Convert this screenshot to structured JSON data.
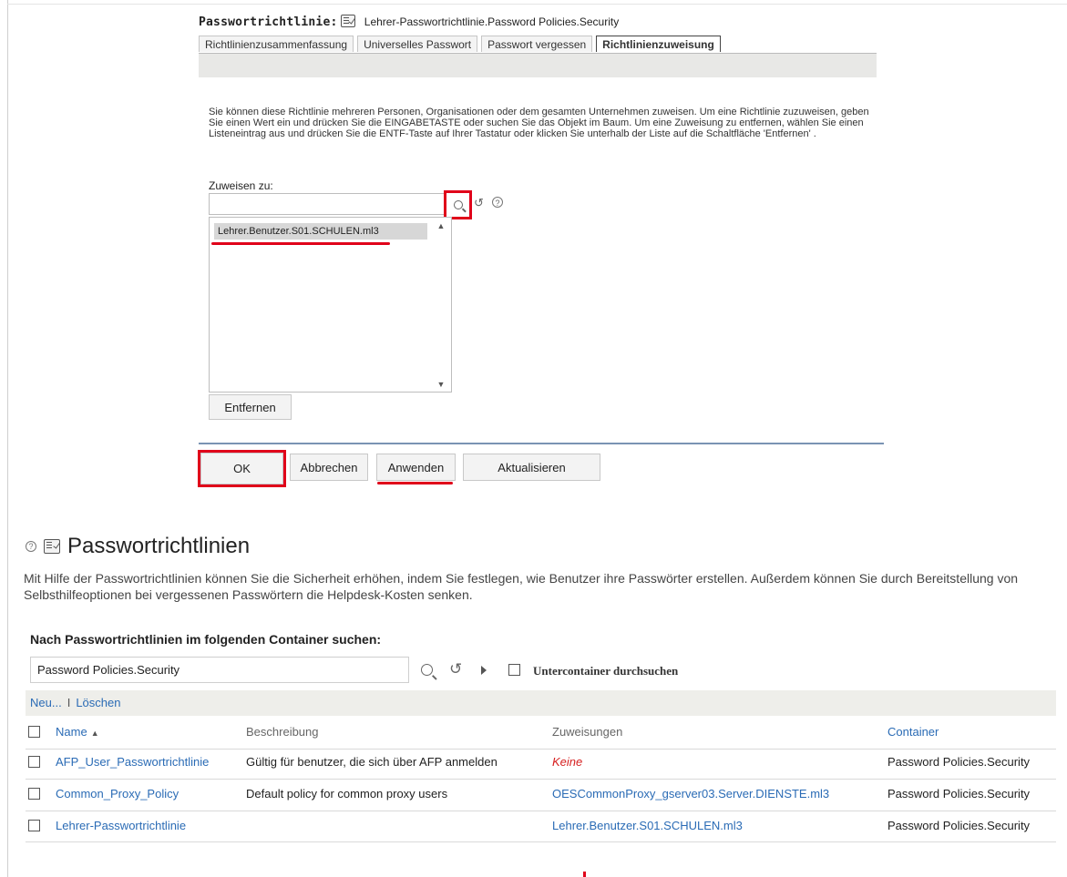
{
  "dialog": {
    "title_label": "Passwortrichtlinie:",
    "object_name": "Lehrer-Passwortrichtlinie.Password Policies.Security",
    "tabs": [
      {
        "label": "Richtlinienzusammenfassung",
        "active": false
      },
      {
        "label": "Universelles Passwort",
        "active": false
      },
      {
        "label": "Passwort vergessen",
        "active": false
      },
      {
        "label": "Richtlinienzuweisung",
        "active": true
      }
    ],
    "description": "Sie können diese Richtlinie mehreren Personen, Organisationen oder dem gesamten Unternehmen zuweisen. Um eine Richtlinie zuzuweisen, geben Sie einen Wert ein und drücken Sie die EINGABETASTE oder suchen Sie das Objekt im Baum. Um eine Zuweisung zu entfernen, wählen Sie einen Listeneintrag aus und drücken Sie die ENTF-Taste auf Ihrer Tastatur oder klicken Sie unterhalb der Liste auf die Schaltfläche 'Entfernen' .",
    "assign_label": "Zuweisen zu:",
    "assign_value": "",
    "assigned_items": [
      "Lehrer.Benutzer.S01.SCHULEN.ml3"
    ],
    "remove_button": "Entfernen",
    "buttons": {
      "ok": "OK",
      "cancel": "Abbrechen",
      "apply": "Anwenden",
      "refresh": "Aktualisieren"
    }
  },
  "page": {
    "title": "Passwortrichtlinien",
    "intro": "Mit Hilfe der Passwortrichtlinien können Sie die Sicherheit erhöhen, indem Sie festlegen, wie Benutzer ihre Passwörter erstellen. Außerdem können Sie durch Bereitstellung von Selbsthilfeoptionen bei vergessenen Passwörtern die Helpdesk-Kosten senken.",
    "search_label": "Nach Passwortrichtlinien im folgenden Container suchen:",
    "container_value": "Password Policies.Security",
    "subcontainer_label": "Untercontainer durchsuchen",
    "actions": {
      "new": "Neu...",
      "separator": "I",
      "delete": "Löschen"
    },
    "columns": {
      "name": "Name",
      "description": "Beschreibung",
      "assignments": "Zuweisungen",
      "container": "Container"
    },
    "rows": [
      {
        "name": "AFP_User_Passwortrichtlinie",
        "description": "Gültig für benutzer, die sich über AFP anmelden",
        "assignments": "Keine",
        "container": "Password Policies.Security"
      },
      {
        "name": "Common_Proxy_Policy",
        "description": "Default policy for common proxy users",
        "assignments": "OESCommonProxy_gserver03.Server.DIENSTE.ml3",
        "container": "Password Policies.Security"
      },
      {
        "name": "Lehrer-Passwortrichtlinie",
        "description": "",
        "assignments": "Lehrer.Benutzer.S01.SCHULEN.ml3",
        "container": "Password Policies.Security"
      }
    ]
  },
  "colors": {
    "highlight": "#e0001a",
    "link": "#2a6bb5",
    "none": "#d61f1f"
  },
  "icons": [
    "policy-icon",
    "search-icon",
    "history-icon",
    "help-icon",
    "play-icon",
    "sort-ascending-icon"
  ]
}
